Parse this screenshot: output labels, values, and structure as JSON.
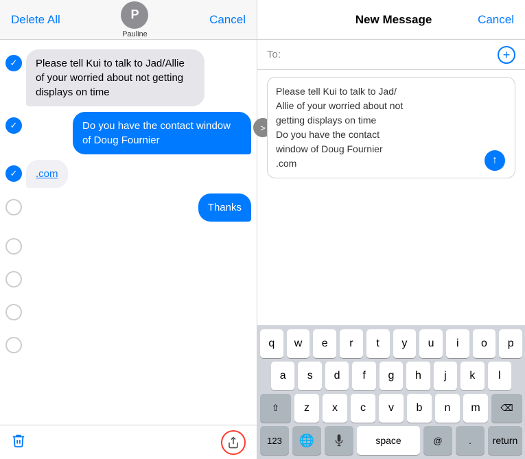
{
  "left_panel": {
    "header": {
      "delete_all_label": "Delete All",
      "cancel_label": "Cancel",
      "avatar_letter": "P",
      "contact_name": "Pauline"
    },
    "messages": [
      {
        "id": 1,
        "checked": true,
        "type": "received",
        "text": "Please tell Kui to talk to Jad/Allie of your worried about not getting displays on time"
      },
      {
        "id": 2,
        "checked": true,
        "type": "sent",
        "text": "Do you have the contact window of Doug Fournier"
      },
      {
        "id": 3,
        "checked": true,
        "type": "received_link",
        "text": ".com"
      },
      {
        "id": 4,
        "checked": false,
        "type": "sent",
        "text": "Thanks"
      },
      {
        "id": 5,
        "checked": false,
        "type": "empty"
      },
      {
        "id": 6,
        "checked": false,
        "type": "empty"
      },
      {
        "id": 7,
        "checked": false,
        "type": "empty"
      },
      {
        "id": 8,
        "checked": false,
        "type": "empty"
      }
    ],
    "bottom": {
      "trash_icon": "🗑",
      "share_hint": "share"
    }
  },
  "right_panel": {
    "header": {
      "title": "New Message",
      "cancel_label": "Cancel"
    },
    "to_field": {
      "label": "To:",
      "placeholder": "",
      "add_icon": "+"
    },
    "compose": {
      "text": "Please tell Kui to talk to Jad/\nAllie of your worried about not\ngetting displays on time\nDo you have the contact\nwindow of Doug Fournier\n.com",
      "expand_icon": ">",
      "send_icon": "↑"
    },
    "keyboard": {
      "rows": [
        [
          "q",
          "w",
          "e",
          "r",
          "t",
          "y",
          "u",
          "i",
          "o",
          "p"
        ],
        [
          "a",
          "s",
          "d",
          "f",
          "g",
          "h",
          "j",
          "k",
          "l"
        ],
        [
          "z",
          "x",
          "c",
          "v",
          "b",
          "n",
          "m"
        ]
      ],
      "shift_icon": "⇧",
      "delete_icon": "⌫",
      "numbers_label": "123",
      "globe_icon": "🌐",
      "mic_icon": "🎤",
      "space_label": "space",
      "at_label": "@",
      "period_label": ".",
      "return_label": "return"
    }
  }
}
